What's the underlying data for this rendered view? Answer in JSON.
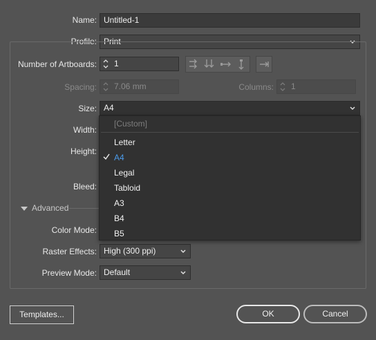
{
  "name": {
    "label": "Name:",
    "value": "Untitled-1"
  },
  "profile": {
    "label": "Profile:",
    "value": "Print"
  },
  "artboards": {
    "label": "Number of Artboards:",
    "value": "1"
  },
  "spacing": {
    "label": "Spacing:",
    "value": "7.06 mm"
  },
  "columns": {
    "label": "Columns:",
    "value": "1"
  },
  "size": {
    "label": "Size:",
    "value": "A4",
    "options": [
      {
        "label": "[Custom]",
        "disabled": true
      },
      {
        "label": "Letter"
      },
      {
        "label": "A4",
        "selected": true
      },
      {
        "label": "Legal"
      },
      {
        "label": "Tabloid"
      },
      {
        "label": "A3"
      },
      {
        "label": "B4"
      },
      {
        "label": "B5"
      }
    ]
  },
  "width": {
    "label": "Width:"
  },
  "height": {
    "label": "Height:"
  },
  "bleed": {
    "label": "Bleed:"
  },
  "advanced": {
    "label": "Advanced"
  },
  "color_mode": {
    "label": "Color Mode:"
  },
  "raster_effects": {
    "label": "Raster Effects:",
    "value": "High (300 ppi)"
  },
  "preview_mode": {
    "label": "Preview Mode:",
    "value": "Default"
  },
  "buttons": {
    "templates": "Templates...",
    "ok": "OK",
    "cancel": "Cancel"
  },
  "colors": {
    "background": "#535353",
    "selected_item": "#4b9bea"
  }
}
